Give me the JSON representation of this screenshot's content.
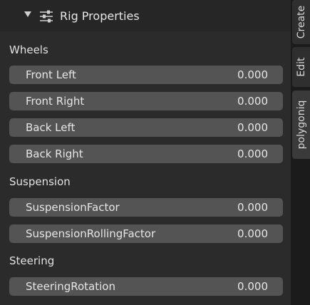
{
  "panel": {
    "title": "Rig Properties"
  },
  "sections": [
    {
      "label": "Wheels",
      "fields": [
        {
          "name": "Front Left",
          "value": "0.000"
        },
        {
          "name": "Front Right",
          "value": "0.000"
        },
        {
          "name": "Back Left",
          "value": "0.000"
        },
        {
          "name": "Back Right",
          "value": "0.000"
        }
      ]
    },
    {
      "label": "Suspension",
      "fields": [
        {
          "name": "SuspensionFactor",
          "value": "0.000"
        },
        {
          "name": "SuspensionRollingFactor",
          "value": "0.000"
        }
      ]
    },
    {
      "label": "Steering",
      "fields": [
        {
          "name": "SteeringRotation",
          "value": "0.000"
        }
      ]
    }
  ],
  "tabs": [
    "Create",
    "Edit",
    "polygoniq"
  ]
}
